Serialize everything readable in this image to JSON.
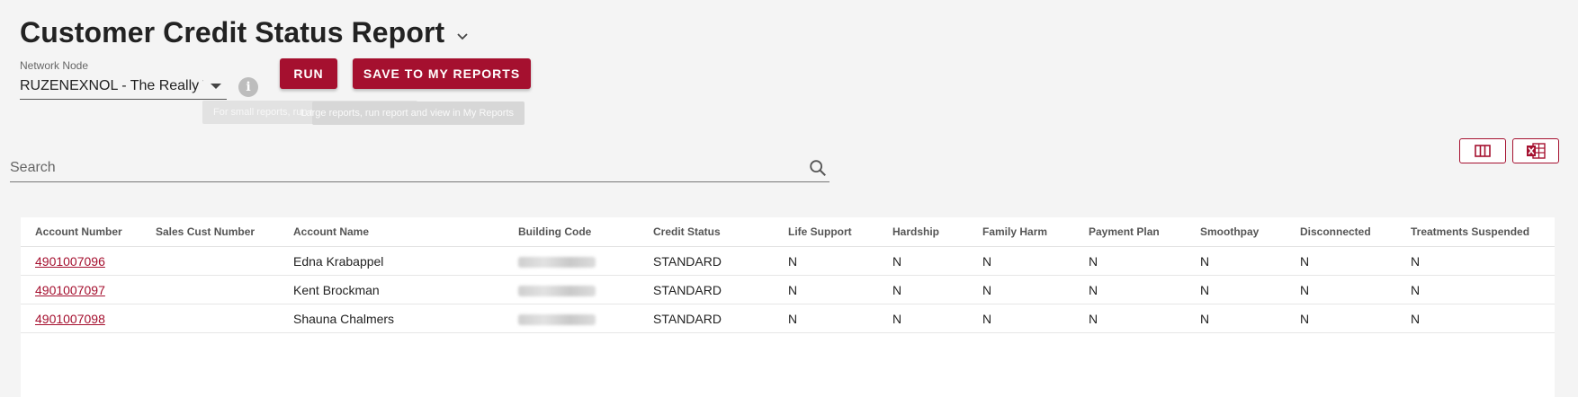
{
  "page": {
    "title": "Customer Credit Status Report"
  },
  "network_node": {
    "label": "Network Node",
    "value": "RUZENEXNOL - The Really Tall"
  },
  "actions": {
    "run_label": "RUN",
    "save_label": "SAVE TO MY REPORTS"
  },
  "tooltips": {
    "run_tip": "For small reports, run report and view below",
    "save_tip": "Large reports, run report and view in My Reports"
  },
  "search": {
    "placeholder": "Search"
  },
  "colors": {
    "accent": "#a5102f",
    "background": "#f4f4f4"
  },
  "table": {
    "columns": [
      "Account Number",
      "Sales Cust Number",
      "Account Name",
      "Building Code",
      "Credit Status",
      "Life Support",
      "Hardship",
      "Family Harm",
      "Payment Plan",
      "Smoothpay",
      "Disconnected",
      "Treatments Suspended"
    ],
    "rows": [
      {
        "account_number": "4901007096",
        "sales_cust_number": "",
        "account_name": "Edna Krabappel",
        "building_code": "RUZENEXNOL",
        "credit_status": "STANDARD",
        "life_support": "N",
        "hardship": "N",
        "family_harm": "N",
        "payment_plan": "N",
        "smoothpay": "N",
        "disconnected": "N",
        "treatments_suspended": "N"
      },
      {
        "account_number": "4901007097",
        "sales_cust_number": "",
        "account_name": "Kent Brockman",
        "building_code": "RUZENEXNOL",
        "credit_status": "STANDARD",
        "life_support": "N",
        "hardship": "N",
        "family_harm": "N",
        "payment_plan": "N",
        "smoothpay": "N",
        "disconnected": "N",
        "treatments_suspended": "N"
      },
      {
        "account_number": "4901007098",
        "sales_cust_number": "",
        "account_name": "Shauna Chalmers",
        "building_code": "RUZENEXNOL",
        "credit_status": "STANDARD",
        "life_support": "N",
        "hardship": "N",
        "family_harm": "N",
        "payment_plan": "N",
        "smoothpay": "N",
        "disconnected": "N",
        "treatments_suspended": "N"
      }
    ]
  }
}
